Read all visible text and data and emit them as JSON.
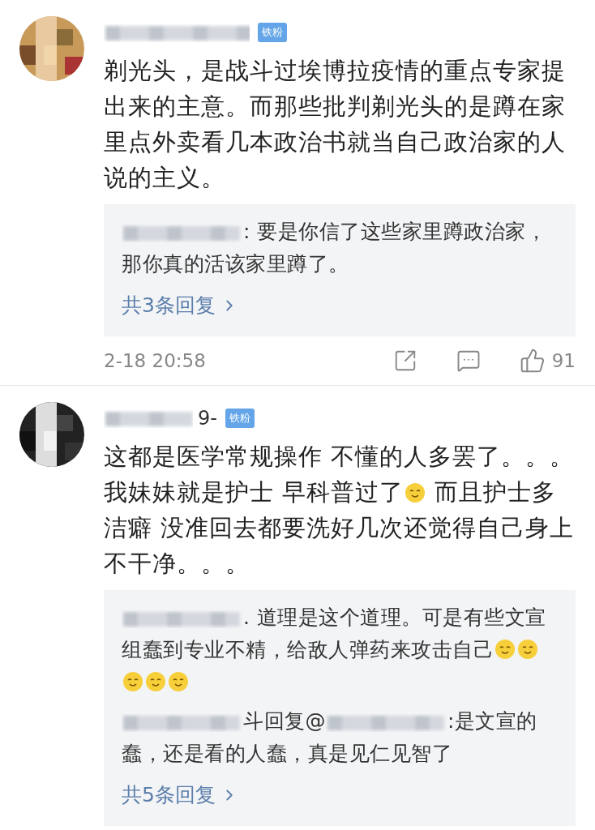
{
  "comments": [
    {
      "avatar": {
        "kind": "picture"
      },
      "badge": "铁粉",
      "body": [
        {
          "kind": "text",
          "text": "剃光头，是战斗过埃博拉疫情的重点专家提出来的主意。而那些批判剃光头的是蹲在家里点外卖看几本政治书就当自己政治家的人说的主义。"
        }
      ],
      "replies": [
        {
          "segments": [
            {
              "kind": "blurred"
            },
            {
              "kind": "text",
              "text": ": 要是你信了这些家里蹲政治家，那你真的活该家里蹲了。"
            }
          ]
        }
      ],
      "more_replies": "共3条回复",
      "time": "2-18 20:58",
      "likes": "91"
    },
    {
      "avatar": {
        "kind": "picture"
      },
      "name_tail": "9-",
      "badge": "铁粉",
      "body": [
        {
          "kind": "text",
          "text": "这都是医学常规操作 不懂的人多罢了。。。我妹妹就是护士 早科普过了"
        },
        {
          "kind": "emoji"
        },
        {
          "kind": "text",
          "text": " 而且护士多洁癖 没准回去都要洗好几次还觉得自己身上不干净。。。"
        }
      ],
      "replies": [
        {
          "segments": [
            {
              "kind": "blurred"
            },
            {
              "kind": "text",
              "text": ". 道理是这个道理。可是有些文宣组蠢到专业不精，给敌人弹药来攻击自己"
            },
            {
              "kind": "emoji"
            },
            {
              "kind": "emoji"
            },
            {
              "kind": "emoji"
            },
            {
              "kind": "emoji"
            },
            {
              "kind": "emoji"
            }
          ]
        },
        {
          "segments": [
            {
              "kind": "blurred"
            },
            {
              "kind": "text",
              "text": "斗回复@"
            },
            {
              "kind": "blurred"
            },
            {
              "kind": "text",
              "text": ":是文宣的蠢，还是看的人蠢，真是见仁见智了"
            }
          ]
        }
      ],
      "more_replies": "共5条回复"
    }
  ]
}
